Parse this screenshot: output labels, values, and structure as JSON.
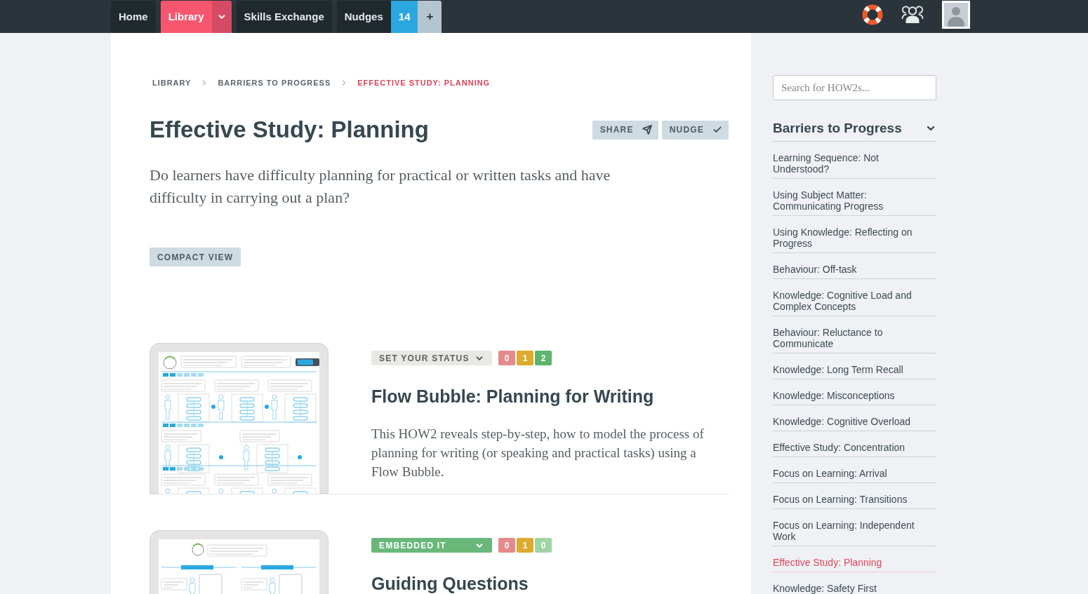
{
  "nav": {
    "items": [
      {
        "label": "Home",
        "selected": false,
        "has_menu": false
      },
      {
        "label": "Library",
        "selected": true,
        "has_menu": true
      },
      {
        "label": "Skills Exchange",
        "selected": false,
        "has_menu": false
      },
      {
        "label": "Nudges",
        "selected": false,
        "has_menu": false,
        "count": "14",
        "action": "+"
      }
    ]
  },
  "breadcrumb": [
    {
      "label": "LIBRARY",
      "selected": false
    },
    {
      "label": "BARRIERS TO PROGRESS",
      "selected": false
    },
    {
      "label": "EFFECTIVE STUDY: PLANNING",
      "selected": true
    }
  ],
  "page": {
    "title": "Effective Study: Planning",
    "actions": [
      {
        "label": "SHARE",
        "kind": "share"
      },
      {
        "label": "NUDGE",
        "kind": "nudge"
      }
    ],
    "description": "Do learners have difficulty planning for practical or written tasks and have difficulty in carrying out a plan?",
    "view_button": "COMPACT VIEW"
  },
  "cards": [
    {
      "status": {
        "label": "SET YOUR STATUS",
        "kind": "unset"
      },
      "counts": [
        {
          "value": "0",
          "color": "#e48a8c"
        },
        {
          "value": "1",
          "color": "#dcab2f"
        },
        {
          "value": "2",
          "color": "#5cb56c"
        }
      ],
      "title": "Flow Bubble: Planning for Writing",
      "description": "This HOW2 reveals step-by-step, how to model the process of planning for writing (or speaking and practical tasks) using a Flow Bubble."
    },
    {
      "status": {
        "label": "EMBEDDED IT",
        "kind": "embedded"
      },
      "counts": [
        {
          "value": "0",
          "color": "#e48a8c"
        },
        {
          "value": "1",
          "color": "#dcab2f"
        },
        {
          "value": "0",
          "color": "#9fd5a4"
        }
      ],
      "title": "Guiding Questions"
    }
  ],
  "sidebar": {
    "search": {
      "placeholder": "Search for HOW2s..."
    },
    "section": {
      "title": "Barriers to Progress",
      "expanded": true
    },
    "items": [
      {
        "label": "Learning Sequence: Not Understood?",
        "selected": false
      },
      {
        "label": "Using Subject Matter: Communicating Progress",
        "selected": false
      },
      {
        "label": "Using Knowledge: Reflecting on Progress",
        "selected": false
      },
      {
        "label": "Behaviour: Off-task",
        "selected": false
      },
      {
        "label": "Knowledge: Cognitive Load and Complex Concepts",
        "selected": false
      },
      {
        "label": "Behaviour: Reluctance to Communicate",
        "selected": false
      },
      {
        "label": "Knowledge: Long Term Recall",
        "selected": false
      },
      {
        "label": "Knowledge: Misconceptions",
        "selected": false
      },
      {
        "label": "Knowledge: Cognitive Overload",
        "selected": false
      },
      {
        "label": "Effective Study: Concentration",
        "selected": false
      },
      {
        "label": "Focus on Learning: Arrival",
        "selected": false
      },
      {
        "label": "Focus on Learning: Transitions",
        "selected": false
      },
      {
        "label": "Focus on Learning: Independent Work",
        "selected": false
      },
      {
        "label": "Effective Study: Planning",
        "selected": true
      },
      {
        "label": "Knowledge: Safety First",
        "selected": false
      }
    ]
  }
}
